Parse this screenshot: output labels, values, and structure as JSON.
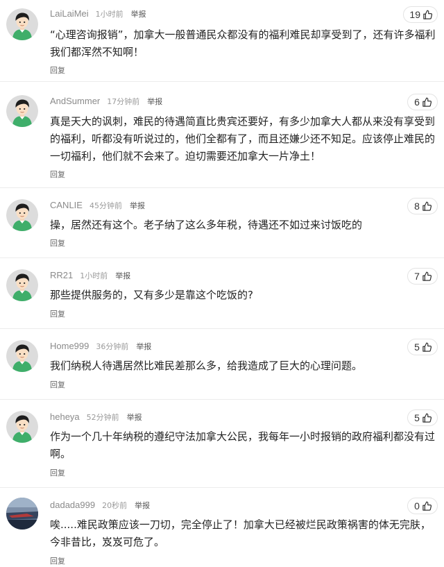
{
  "comments": [
    {
      "username": "LaiLaiMei",
      "time": "1小时前",
      "report": "举报",
      "likes": "19",
      "text": "“心理咨询报销”，加拿大一般普通民众都没有的福利难民却享受到了，还有许多福利我们都浑然不知啊！",
      "reply": "回复",
      "avatar": "cartoon-boy-avatar"
    },
    {
      "username": "AndSummer",
      "time": "17分钟前",
      "report": "举报",
      "likes": "6",
      "text": "真是天大的讽刺，难民的待遇简直比贵宾还要好，有多少加拿大人都从来没有享受到的福利，听都没有听说过的，他们全都有了，而且还嫌少还不知足。应该停止难民的一切福利，他们就不会来了。迫切需要还加拿大一片净土！",
      "reply": "回复",
      "avatar": "cartoon-boy-avatar"
    },
    {
      "username": "CANLIE",
      "time": "45分钟前",
      "report": "举报",
      "likes": "8",
      "text": "操，居然还有这个。老子纳了这么多年税，待遇还不如过来讨饭吃的",
      "reply": "回复",
      "avatar": "cartoon-boy-avatar"
    },
    {
      "username": "RR21",
      "time": "1小时前",
      "report": "举报",
      "likes": "7",
      "text": "那些提供服务的，又有多少是靠这个吃饭的?",
      "reply": "回复",
      "avatar": "cartoon-boy-avatar"
    },
    {
      "username": "Home999",
      "time": "36分钟前",
      "report": "举报",
      "likes": "5",
      "text": "我们纳税人待遇居然比难民差那么多，给我造成了巨大的心理问题。",
      "reply": "回复",
      "avatar": "cartoon-boy-avatar"
    },
    {
      "username": "heheya",
      "time": "52分钟前",
      "report": "举报",
      "likes": "5",
      "text": "作为一个几十年纳税的遵纪守法加拿大公民，我每年一小时报销的政府福利都没有过啊。",
      "reply": "回复",
      "avatar": "cartoon-boy-avatar"
    },
    {
      "username": "dadada999",
      "time": "20秒前",
      "report": "举报",
      "likes": "0",
      "text": "唉.....难民政策应该一刀切，完全停止了！加拿大已经被烂民政策祸害的体无完肤，今非昔比，岌岌可危了。",
      "reply": "回复",
      "avatar": "sea-photo-avatar"
    }
  ]
}
